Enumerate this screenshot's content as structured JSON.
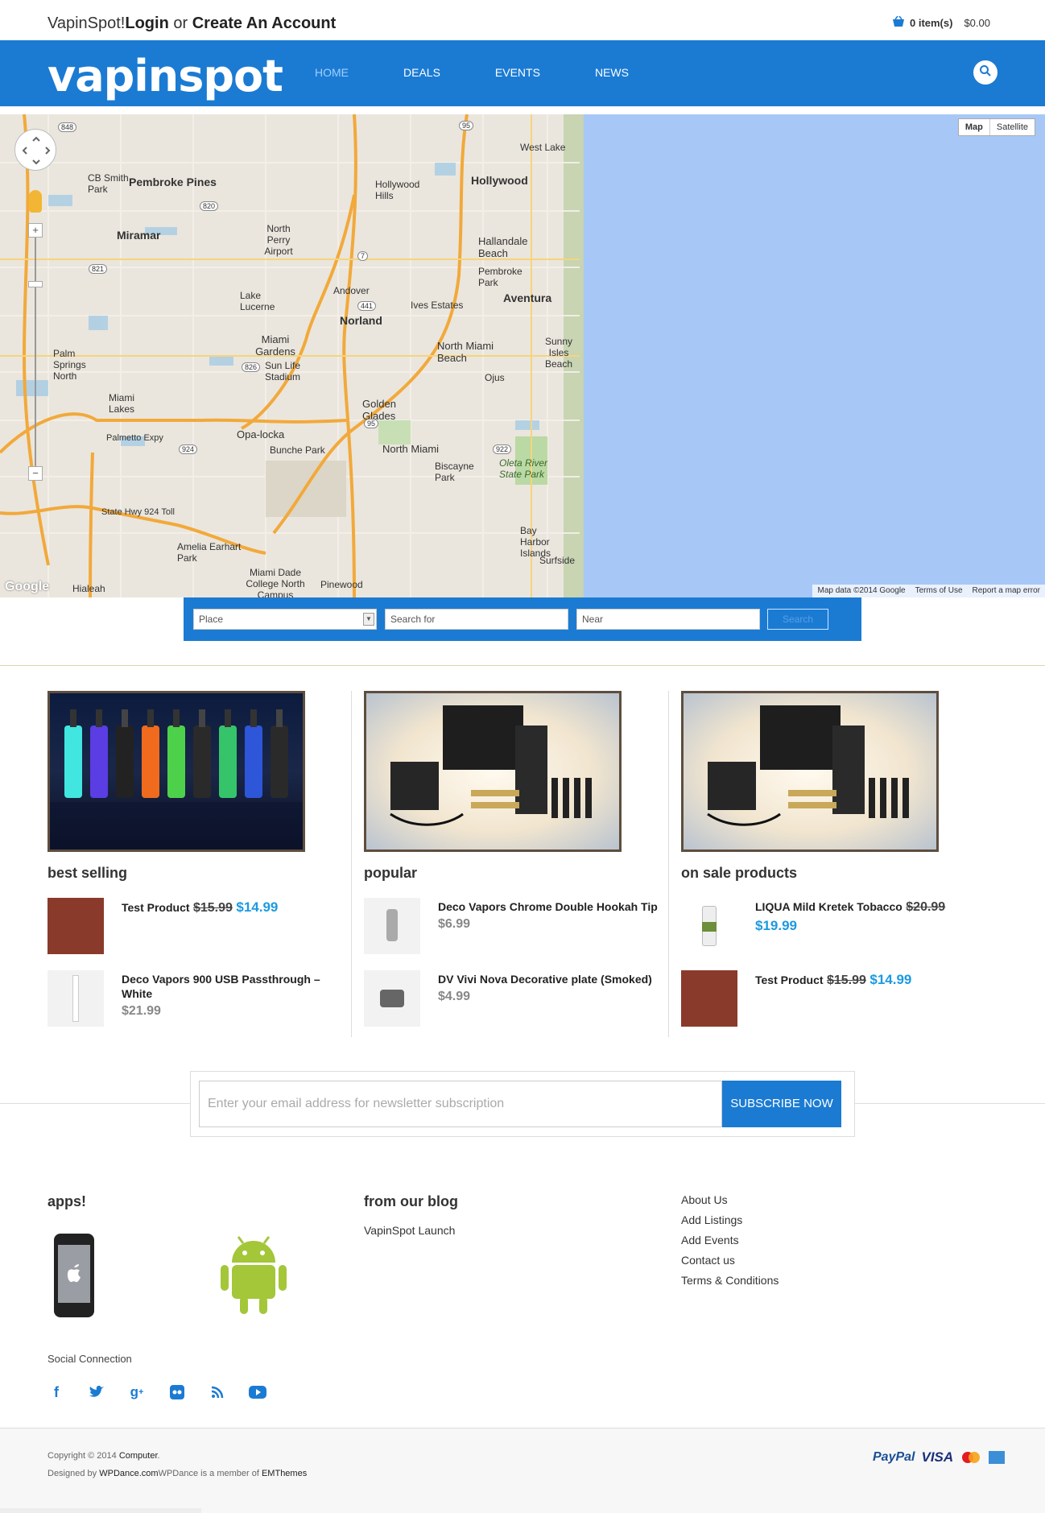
{
  "topbar": {
    "brand": "VapinSpot!",
    "login_label": "Login",
    "or_text": "or",
    "register_label": "Create An Account",
    "cart_items": "0 item(s)",
    "cart_amount": "$0.00"
  },
  "header": {
    "logo_text": "vapinspot",
    "nav": [
      "HOME",
      "DEALS",
      "EVENTS",
      "NEWS"
    ],
    "active_nav": "HOME"
  },
  "map": {
    "type_buttons": [
      "Map",
      "Satellite"
    ],
    "attribution": [
      "Map data ©2014 Google",
      "Terms of Use",
      "Report a map error"
    ],
    "logo": "Google",
    "places": [
      "Pembroke Pines",
      "Miramar",
      "Hollywood",
      "Hallandale Beach",
      "Aventura",
      "Norland",
      "Miami Gardens",
      "North Miami Beach",
      "Golden Glades",
      "North Miami",
      "Opa-locka",
      "Miami Lakes",
      "Palm Springs North",
      "Lake Lucerne",
      "Andover",
      "Ives Estates",
      "Sunny Isles Beach",
      "Oleta River State Park",
      "Biscayne Park",
      "Bay Harbor Islands",
      "Surfside",
      "Amelia Earhart Park",
      "Miami Dade College North Campus",
      "Pinewood",
      "CB Smith Park",
      "North Perry Airport",
      "Hollywood Hills",
      "Pembroke Park",
      "West Lake",
      "Ojus",
      "Sun Life Stadium",
      "Bunche Park",
      "Hialeah",
      "Palmetto Expy",
      "State Hwy 924 Toll"
    ]
  },
  "search": {
    "place_value": "Place",
    "search_placeholder": "Search for",
    "near_placeholder": "Near",
    "button_label": "Search"
  },
  "columns": [
    {
      "title": "best selling",
      "products": [
        {
          "name": "Test Product",
          "old_price": "$15.99",
          "price": "$14.99"
        },
        {
          "name": "Deco Vapors 900 USB Passthrough – White",
          "price": "$21.99"
        }
      ]
    },
    {
      "title": "popular",
      "products": [
        {
          "name": "Deco Vapors Chrome Double Hookah Tip",
          "price": "$6.99"
        },
        {
          "name": "DV Vivi Nova Decorative plate (Smoked)",
          "price": "$4.99"
        }
      ]
    },
    {
      "title": "on sale products",
      "products": [
        {
          "name": "LIQUA Mild Kretek Tobacco",
          "old_price": "$20.99",
          "price": "$19.99"
        },
        {
          "name": "Test Product",
          "old_price": "$15.99",
          "price": "$14.99"
        }
      ]
    }
  ],
  "newsletter": {
    "placeholder": "Enter your email address for newsletter subscription",
    "button_label": "SUBSCRIBE NOW"
  },
  "footer": {
    "apps_title": "apps!",
    "blog_title": "from our blog",
    "blog_posts": [
      "VapinSpot Launch"
    ],
    "links": [
      "About Us",
      "Add Listings",
      "Add Events",
      "Contact us",
      "Terms & Conditions"
    ],
    "social_title": "Social Connection",
    "social_icons": [
      "facebook-icon",
      "twitter-icon",
      "google-plus-icon",
      "flickr-icon",
      "rss-icon",
      "youtube-icon"
    ],
    "copyright_prefix": "Copyright © 2014",
    "copyright_link": "Computer",
    "designed_prefix": "Designed by",
    "designed_link": "WPDance.com",
    "member_text": "WPDance is a member of",
    "member_link": "EMThemes",
    "payments": [
      "PayPal",
      "VISA"
    ]
  },
  "colors": {
    "brand_blue": "#1b7bd3",
    "price_blue": "#1b9ae0",
    "sea": "#a7c8f6"
  }
}
